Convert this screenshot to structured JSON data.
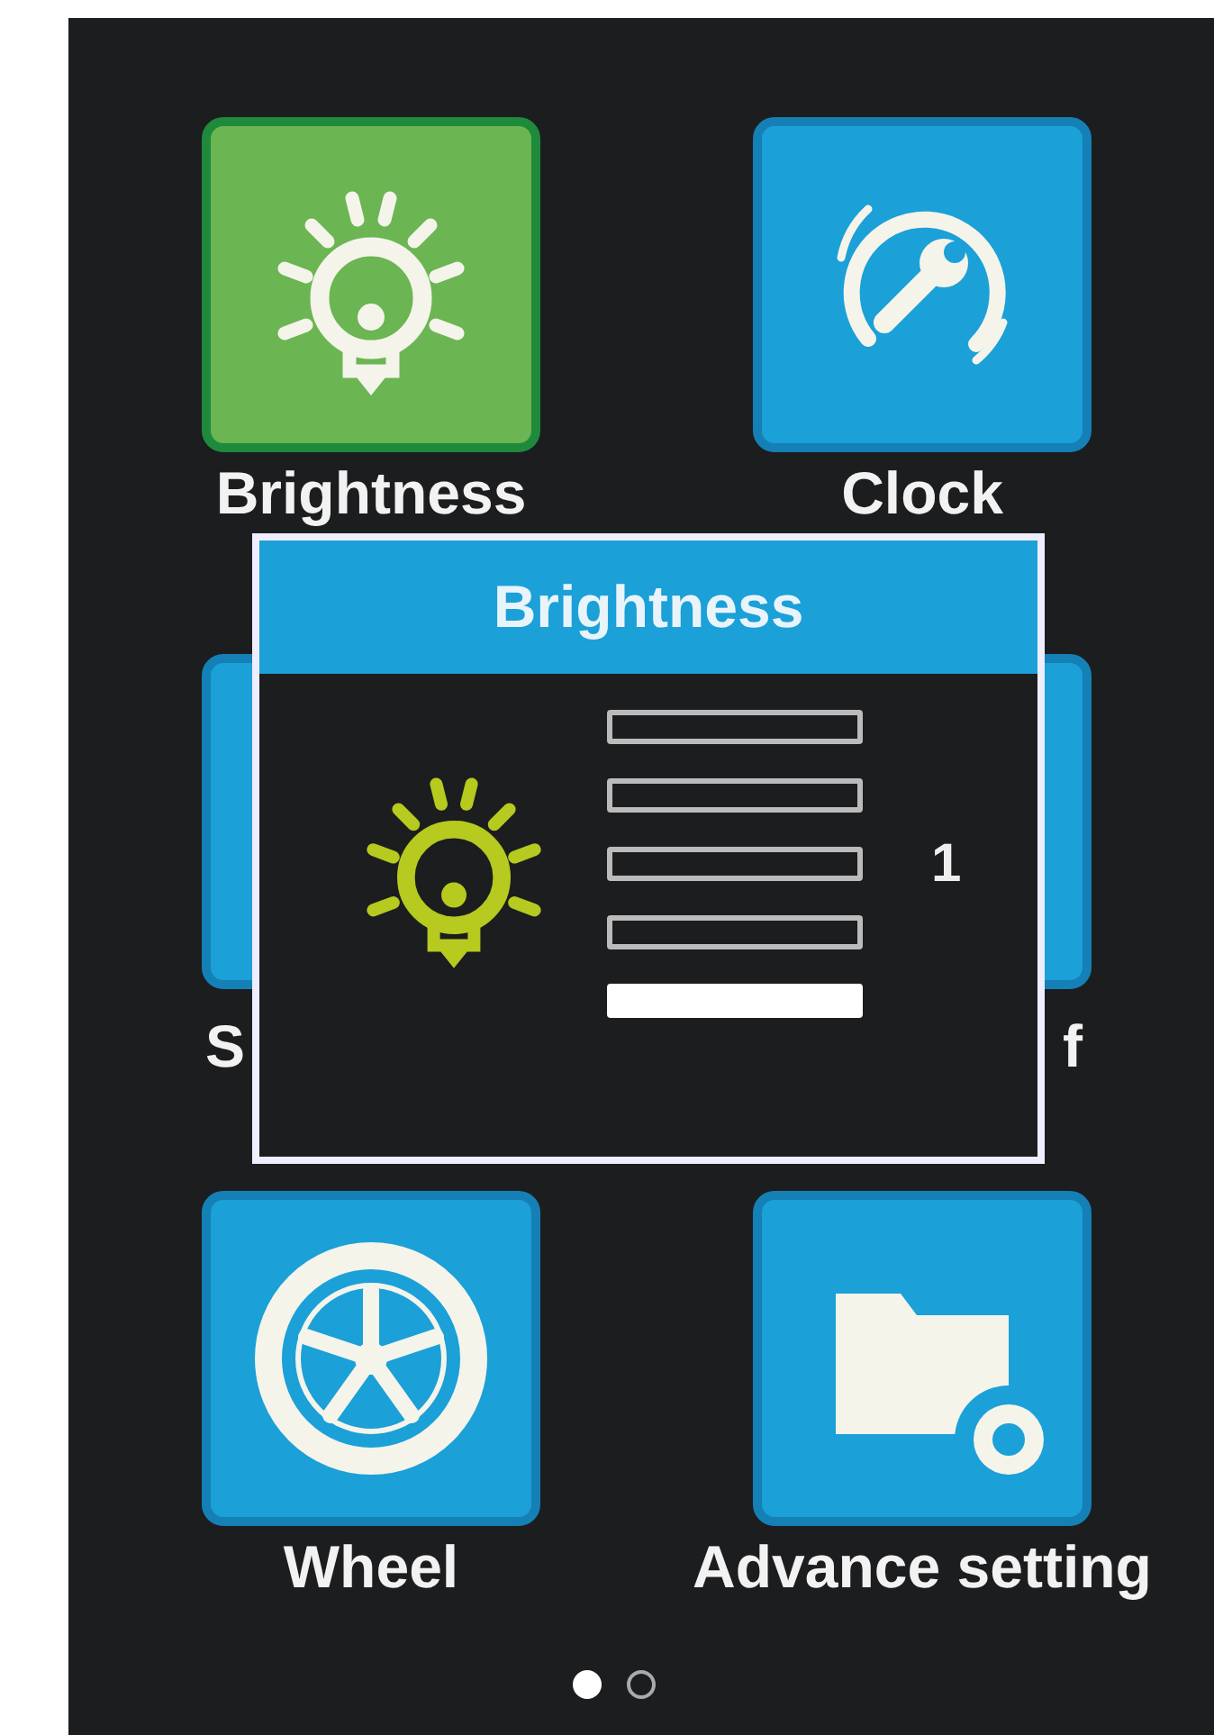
{
  "menu": {
    "tiles": [
      {
        "label": "Brightness",
        "selected": true,
        "kind": "bulb"
      },
      {
        "label": "Clock",
        "selected": false,
        "kind": "gauge"
      },
      {
        "label": "S",
        "selected": false,
        "kind": "covered-start"
      },
      {
        "label": "f",
        "selected": false,
        "kind": "covered-end"
      },
      {
        "label": "Wheel",
        "selected": false,
        "kind": "wheel"
      },
      {
        "label": "Advance setting",
        "selected": false,
        "kind": "folder"
      }
    ]
  },
  "dialog": {
    "title": "Brightness",
    "level": 0.2,
    "reading": "1"
  },
  "pager": [
    {
      "selected": true
    },
    {
      "selected": false
    }
  ]
}
